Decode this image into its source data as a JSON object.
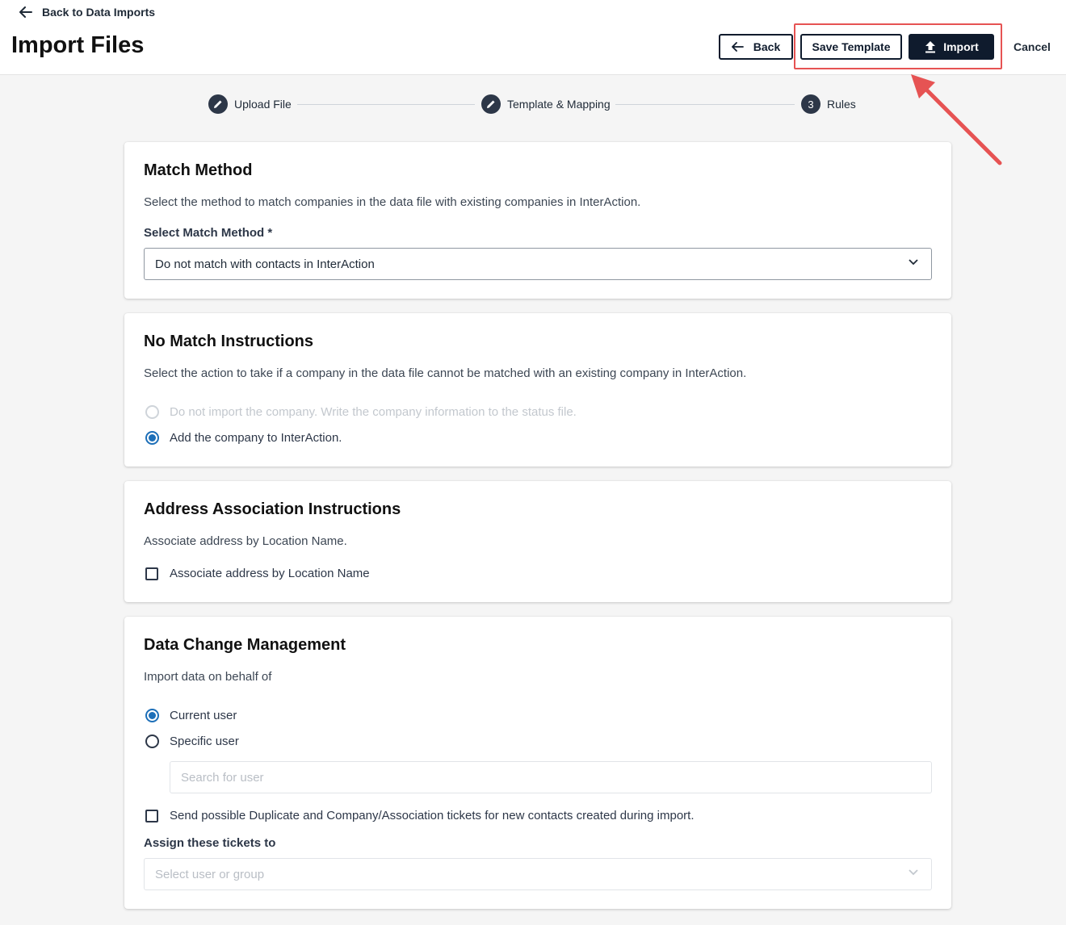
{
  "header": {
    "back_link": "Back to Data Imports",
    "title": "Import Files",
    "back_button": "Back",
    "save_template_button": "Save Template",
    "import_button": "Import",
    "cancel_button": "Cancel",
    "annotation_color": "#e65353"
  },
  "stepper": {
    "steps": [
      {
        "label": "Upload File",
        "state": "done"
      },
      {
        "label": "Template & Mapping",
        "state": "done"
      },
      {
        "label": "Rules",
        "number": "3",
        "state": "current"
      }
    ]
  },
  "match_method": {
    "title": "Match Method",
    "description": "Select the method to match companies in the data file with existing companies in InterAction.",
    "label": "Select Match Method *",
    "selected": "Do not match with contacts in InterAction"
  },
  "no_match": {
    "title": "No Match Instructions",
    "description": "Select the action to take if a company in the data file cannot be matched with an existing company in InterAction.",
    "options": [
      {
        "label": "Do not import the company. Write the company information to the status file.",
        "checked": false,
        "disabled": true
      },
      {
        "label": "Add the company to InterAction.",
        "checked": true,
        "disabled": false
      }
    ]
  },
  "address": {
    "title": "Address Association Instructions",
    "description": "Associate address by Location Name.",
    "checkbox_label": "Associate address by Location Name"
  },
  "data_change": {
    "title": "Data Change Management",
    "description": "Import data on behalf of",
    "options": [
      {
        "label": "Current user",
        "checked": true
      },
      {
        "label": "Specific user",
        "checked": false
      }
    ],
    "search_placeholder": "Search for user",
    "tickets_checkbox_label": "Send possible Duplicate and Company/Association tickets for new contacts created during import.",
    "assign_label": "Assign these tickets to",
    "assign_placeholder": "Select user or group"
  }
}
